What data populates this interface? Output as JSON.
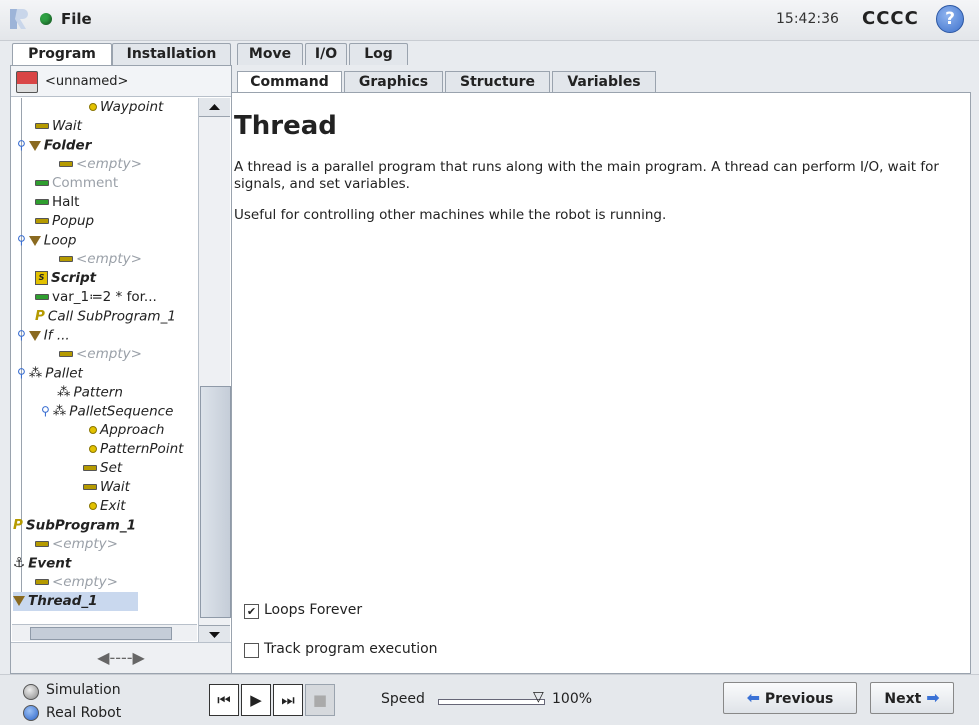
{
  "header": {
    "file_label": "File",
    "clock": "15:42:36",
    "robot_name": "CCCC",
    "help_glyph": "?"
  },
  "main_tabs": [
    "Program",
    "Installation",
    "Move",
    "I/O",
    "Log"
  ],
  "program": {
    "name": "<unnamed>"
  },
  "tree": [
    {
      "label": "Waypoint"
    },
    {
      "label": "Wait"
    },
    {
      "label": "Folder"
    },
    {
      "label": "<empty>"
    },
    {
      "label": "Comment"
    },
    {
      "label": "Halt"
    },
    {
      "label": "Popup"
    },
    {
      "label": "Loop"
    },
    {
      "label": "<empty>"
    },
    {
      "label": "Script"
    },
    {
      "label": "var_1≔2 * for..."
    },
    {
      "label": "Call SubProgram_1"
    },
    {
      "label": "If ..."
    },
    {
      "label": "<empty>"
    },
    {
      "label": "Pallet"
    },
    {
      "label": "Pattern"
    },
    {
      "label": "PalletSequence"
    },
    {
      "label": "Approach"
    },
    {
      "label": "PatternPoint"
    },
    {
      "label": "Set"
    },
    {
      "label": "Wait"
    },
    {
      "label": "Exit"
    },
    {
      "label": "SubProgram_1"
    },
    {
      "label": "<empty>"
    },
    {
      "label": "Event"
    },
    {
      "label": "<empty>"
    },
    {
      "label": "Thread_1"
    }
  ],
  "sub_tabs": [
    "Command",
    "Graphics",
    "Structure",
    "Variables"
  ],
  "command": {
    "title": "Thread",
    "description": "A thread is a parallel program that runs along with the main program. A thread can perform I/O, wait for signals, and set variables.",
    "note": "Useful for controlling other machines while the robot is running.",
    "loops_forever_label": "Loops Forever",
    "loops_forever_checked": true,
    "track_label": "Track program execution",
    "track_checked": false
  },
  "bottom": {
    "simulation_label": "Simulation",
    "real_robot_label": "Real Robot",
    "selected_mode": "Real Robot",
    "speed_label": "Speed",
    "speed_value": "100%",
    "speed_fraction": 1.0,
    "previous_label": "Previous",
    "next_label": "Next"
  },
  "colors": {
    "status_dot": "#2ea043",
    "accent_blue": "#3b72d6",
    "save_icon_red": "#d94545"
  }
}
